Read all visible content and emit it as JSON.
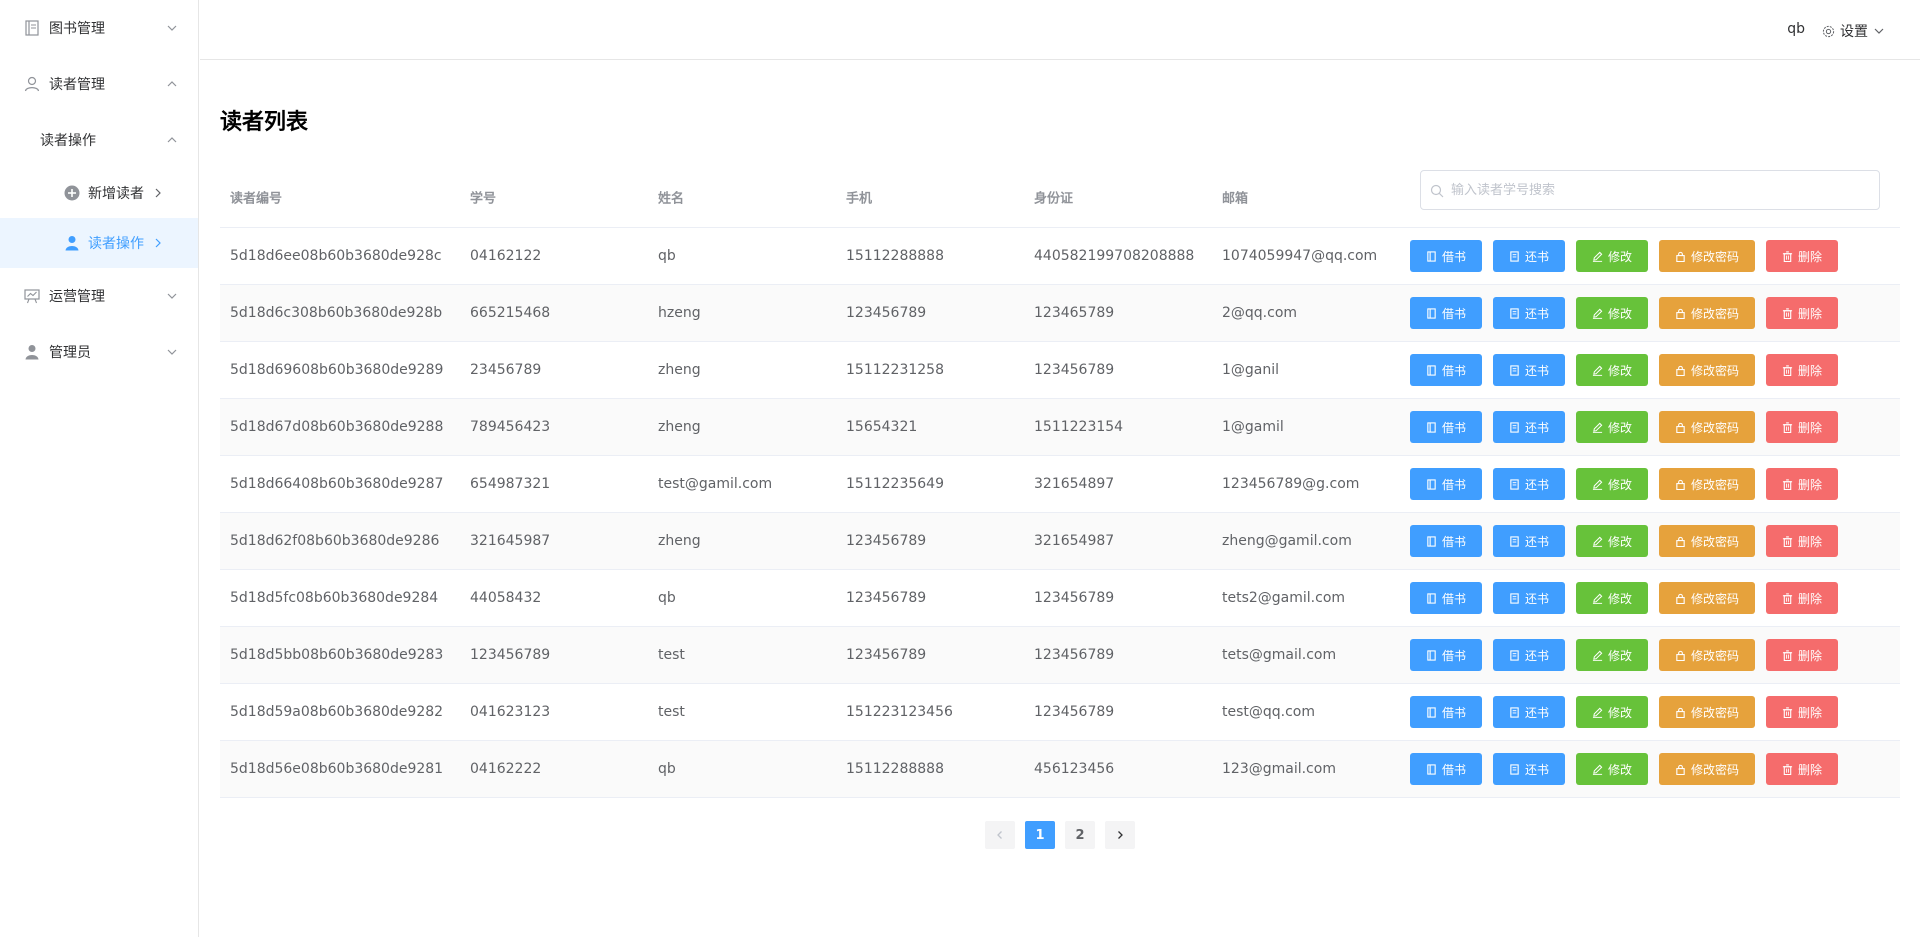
{
  "sidebar": {
    "books_menu": "图书管理",
    "readers_menu": "读者管理",
    "reader_ops_group": "读者操作",
    "add_reader": "新增读者",
    "reader_ops_item": "读者操作",
    "operations_menu": "运营管理",
    "admin_menu": "管理员"
  },
  "header": {
    "username": "qb",
    "settings_label": "设置"
  },
  "page": {
    "title": "读者列表"
  },
  "table": {
    "columns": [
      "读者编号",
      "学号",
      "姓名",
      "手机",
      "身份证",
      "邮箱"
    ],
    "search_placeholder": "输入读者学号搜索",
    "actions": {
      "borrow": "借书",
      "return": "还书",
      "edit": "修改",
      "change_password": "修改密码",
      "delete": "删除"
    },
    "rows": [
      [
        "5d18d6ee08b60b3680de928c",
        "04162122",
        "qb",
        "15112288888",
        "440582199708208888",
        "1074059947@qq.com"
      ],
      [
        "5d18d6c308b60b3680de928b",
        "665215468",
        "hzeng",
        "123456789",
        "123465789",
        "2@qq.com"
      ],
      [
        "5d18d69608b60b3680de9289",
        "23456789",
        "zheng",
        "15112231258",
        "123456789",
        "1@ganil"
      ],
      [
        "5d18d67d08b60b3680de9288",
        "789456423",
        "zheng",
        "15654321",
        "1511223154",
        "1@gamil"
      ],
      [
        "5d18d66408b60b3680de9287",
        "654987321",
        "test@gamil.com",
        "15112235649",
        "321654897",
        "123456789@g.com"
      ],
      [
        "5d18d62f08b60b3680de9286",
        "321645987",
        "zheng",
        "123456789",
        "321654987",
        "zheng@gamil.com"
      ],
      [
        "5d18d5fc08b60b3680de9284",
        "44058432",
        "qb",
        "123456789",
        "123456789",
        "tets2@gamil.com"
      ],
      [
        "5d18d5bb08b60b3680de9283",
        "123456789",
        "test",
        "123456789",
        "123456789",
        "tets@gmail.com"
      ],
      [
        "5d18d59a08b60b3680de9282",
        "041623123",
        "test",
        "151223123456",
        "123456789",
        "test@qq.com"
      ],
      [
        "5d18d56e08b60b3680de9281",
        "04162222",
        "qb",
        "15112288888",
        "456123456",
        "123@gmail.com"
      ]
    ]
  },
  "pagination": {
    "pages": [
      "1",
      "2"
    ],
    "current": "1"
  },
  "colors": {
    "primary": "#409eff",
    "success": "#67c23a",
    "warning": "#e6a23c",
    "danger": "#f56c6c"
  }
}
